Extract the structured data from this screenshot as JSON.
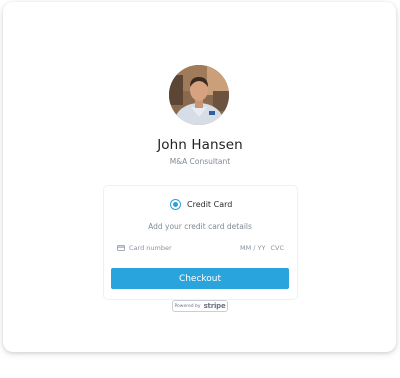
{
  "profile": {
    "name": "John Hansen",
    "title": "M&A Consultant",
    "avatar_alt": "profile-photo"
  },
  "payment": {
    "method_label": "Credit Card",
    "method_selected": true,
    "hint": "Add your credit card details",
    "card_field": {
      "placeholder": "Card number",
      "exp_placeholder": "MM / YY",
      "cvc_placeholder": "CVC"
    },
    "checkout_label": "Checkout"
  },
  "badge": {
    "powered_text": "Powered by",
    "brand_text": "stripe"
  },
  "colors": {
    "accent": "#2aa4dc",
    "radio": "#2d9fd8",
    "muted_text": "#7f8a96"
  },
  "icons": {
    "radio": "radio-selected-icon",
    "card": "credit-card-icon"
  }
}
